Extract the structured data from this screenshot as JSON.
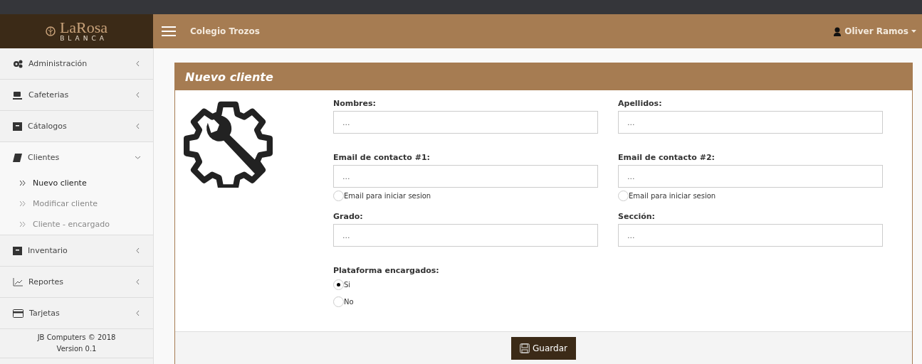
{
  "brand": {
    "name": "LaRosa",
    "subtitle": "BLANCA"
  },
  "header": {
    "title": "Colegio Trozos",
    "user": "Oliver Ramos"
  },
  "sidebar": {
    "items": [
      {
        "label": "Administración",
        "expanded": false
      },
      {
        "label": "Cafeterias",
        "expanded": false
      },
      {
        "label": "Cátalogos",
        "expanded": false
      },
      {
        "label": "Clientes",
        "expanded": true,
        "children": [
          {
            "label": "Nuevo cliente",
            "selected": true
          },
          {
            "label": "Modificar cliente",
            "selected": false
          },
          {
            "label": "Cliente - encargado",
            "selected": false
          }
        ]
      },
      {
        "label": "Inventario",
        "expanded": false
      },
      {
        "label": "Reportes",
        "expanded": false
      },
      {
        "label": "Tarjetas",
        "expanded": false
      }
    ],
    "footer": [
      "JB Computers © 2018",
      "Version 0.1"
    ]
  },
  "form": {
    "title": "Nuevo cliente",
    "rows": [
      [
        {
          "label": "Nombres:",
          "placeholder": "..."
        },
        {
          "label": "Apellidos:",
          "placeholder": "..."
        }
      ],
      [
        {
          "label": "Email de contacto #1:",
          "placeholder": "...",
          "option": {
            "label": "Email para iniciar sesion",
            "checked": false
          }
        },
        {
          "label": "Email de contacto #2:",
          "placeholder": "...",
          "option": {
            "label": "Email para iniciar sesion",
            "checked": false
          }
        }
      ],
      [
        {
          "label": "Grado:",
          "placeholder": "..."
        },
        {
          "label": "Sección:",
          "placeholder": "..."
        }
      ]
    ],
    "platform": {
      "label": "Plataforma encargados:",
      "options": [
        {
          "label": "Si",
          "selected": true
        },
        {
          "label": "No",
          "selected": false
        }
      ]
    },
    "submit": "Guardar"
  }
}
